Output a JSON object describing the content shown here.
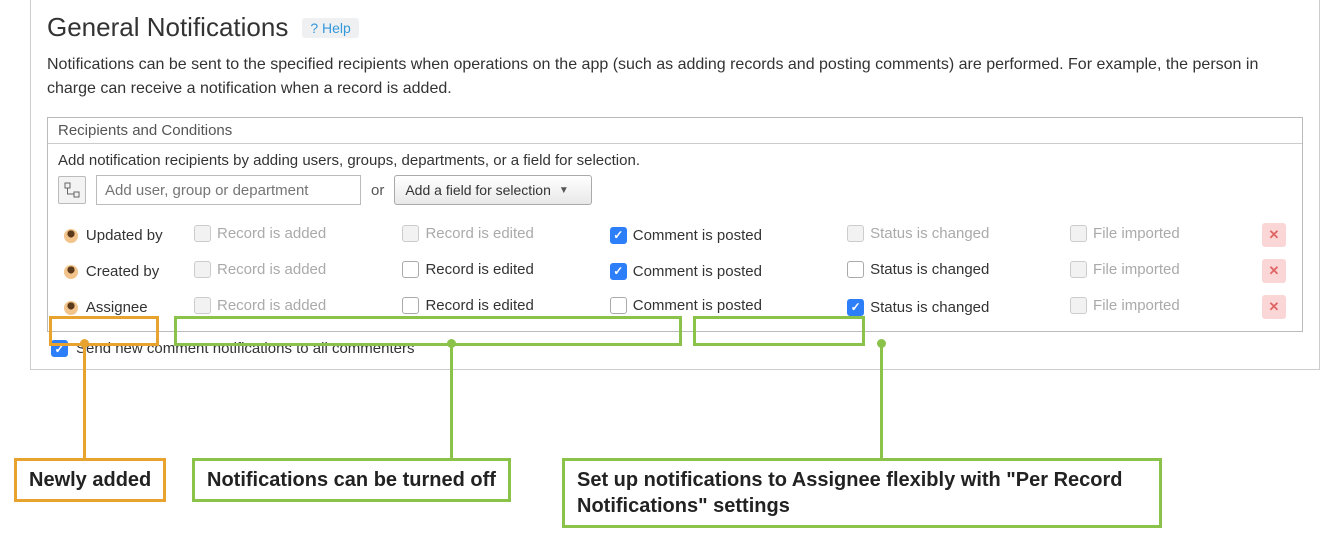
{
  "header": {
    "title": "General Notifications",
    "help_label": "? Help"
  },
  "description": "Notifications can be sent to the specified recipients when operations on the app (such as adding records and posting comments) are performed. For example, the person in charge can receive a notification when a record is added.",
  "section": {
    "title": "Recipients and Conditions",
    "instruction": "Add notification recipients by adding users, groups, departments, or a field for selection.",
    "user_input_placeholder": "Add user, group or department",
    "or_label": "or",
    "field_select_label": "Add a field for selection"
  },
  "columns": {
    "record_added": "Record is added",
    "record_edited": "Record is edited",
    "comment_posted": "Comment is posted",
    "status_changed": "Status is changed",
    "file_imported": "File imported"
  },
  "recipients": [
    {
      "name": "Updated by",
      "record_added": {
        "checked": false,
        "enabled": false
      },
      "record_edited": {
        "checked": false,
        "enabled": false
      },
      "comment_posted": {
        "checked": true,
        "enabled": true
      },
      "status_changed": {
        "checked": false,
        "enabled": false
      },
      "file_imported": {
        "checked": false,
        "enabled": false
      }
    },
    {
      "name": "Created by",
      "record_added": {
        "checked": false,
        "enabled": false
      },
      "record_edited": {
        "checked": false,
        "enabled": true
      },
      "comment_posted": {
        "checked": true,
        "enabled": true
      },
      "status_changed": {
        "checked": false,
        "enabled": true
      },
      "file_imported": {
        "checked": false,
        "enabled": false
      }
    },
    {
      "name": "Assignee",
      "record_added": {
        "checked": false,
        "enabled": false
      },
      "record_edited": {
        "checked": false,
        "enabled": true
      },
      "comment_posted": {
        "checked": false,
        "enabled": true
      },
      "status_changed": {
        "checked": true,
        "enabled": true
      },
      "file_imported": {
        "checked": false,
        "enabled": false
      }
    }
  ],
  "footer_checkbox": {
    "label": "Send new comment notifications to all commenters",
    "checked": true
  },
  "callouts": {
    "newly_added": "Newly added",
    "turned_off": "Notifications can be turned off",
    "flexible": "Set up notifications to Assignee flexibly with \"Per Record Notifications\" settings"
  }
}
